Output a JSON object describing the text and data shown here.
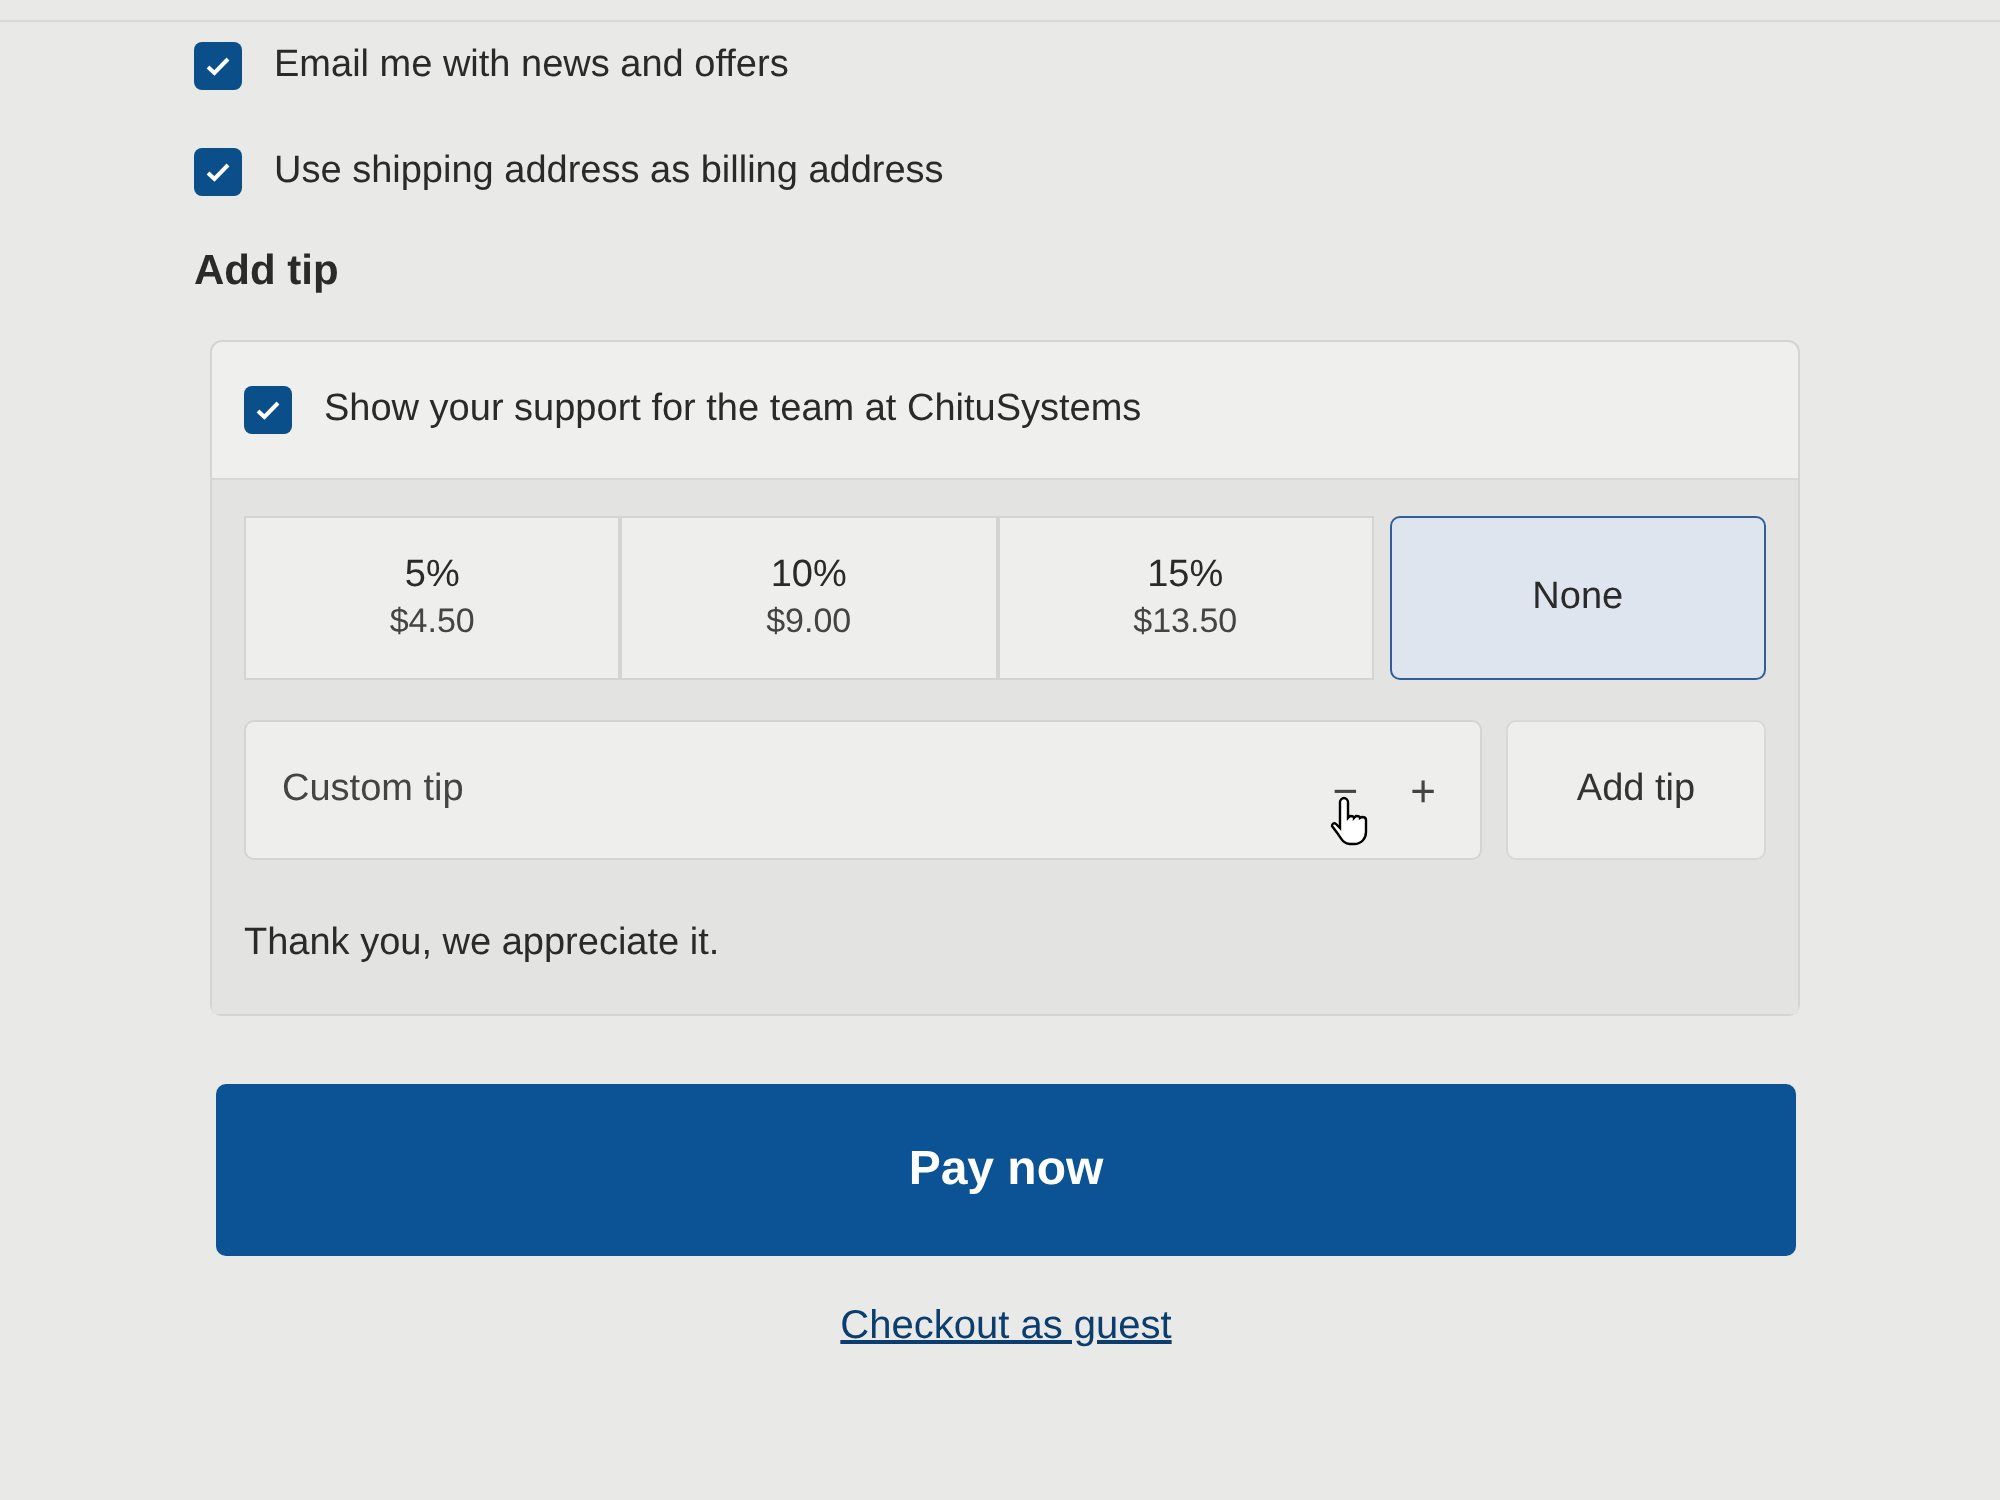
{
  "checkboxes": [
    {
      "label": "Email me with news and offers",
      "checked": true
    },
    {
      "label": "Use shipping address as billing address",
      "checked": true
    }
  ],
  "tip": {
    "heading": "Add tip",
    "support": {
      "label": "Show your support for the team at ChituSystems",
      "checked": true
    },
    "options": [
      {
        "percent": "5%",
        "amount": "$4.50",
        "selected": false
      },
      {
        "percent": "10%",
        "amount": "$9.00",
        "selected": false
      },
      {
        "percent": "15%",
        "amount": "$13.50",
        "selected": false
      },
      {
        "percent": "None",
        "selected": true
      }
    ],
    "custom": {
      "placeholder": "Custom tip",
      "minus": "−",
      "plus": "+"
    },
    "add_button": "Add tip",
    "thanks": "Thank you, we appreciate it."
  },
  "pay_button": "Pay now",
  "guest_link": "Checkout as guest"
}
